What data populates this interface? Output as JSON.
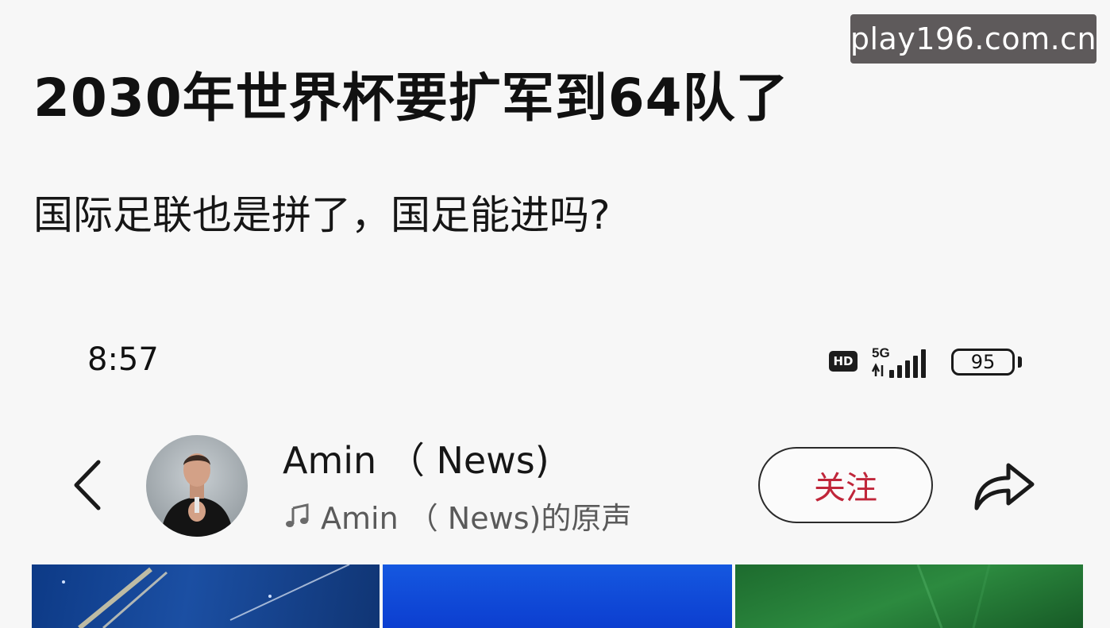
{
  "watermark": {
    "text": "play196.com.cn"
  },
  "headline": "2030年世界杯要扩军到64队了",
  "subline": "国际足联也是拼了，国足能进吗?",
  "status_bar": {
    "time": "8:57",
    "hd_badge": "HD",
    "network": "5G",
    "battery_level": "95",
    "icons": [
      "hd-badge",
      "5g-signal-icon",
      "battery-icon"
    ]
  },
  "post_header": {
    "back_icon": "chevron-left-icon",
    "author_name": "Amin （ News)",
    "sound_label": "Amin （ News)的原声",
    "sound_icon": "music-note-icon",
    "follow_label": "关注",
    "share_icon": "share-arrow-icon"
  },
  "colors": {
    "page_background": "#f7f7f7",
    "watermark_background": "#5e5a5b",
    "follow_text": "#c0263a",
    "thumb_blue": "#0d3a86",
    "thumb_bright_blue": "#1558e0",
    "thumb_green": "#2c8a3f"
  }
}
